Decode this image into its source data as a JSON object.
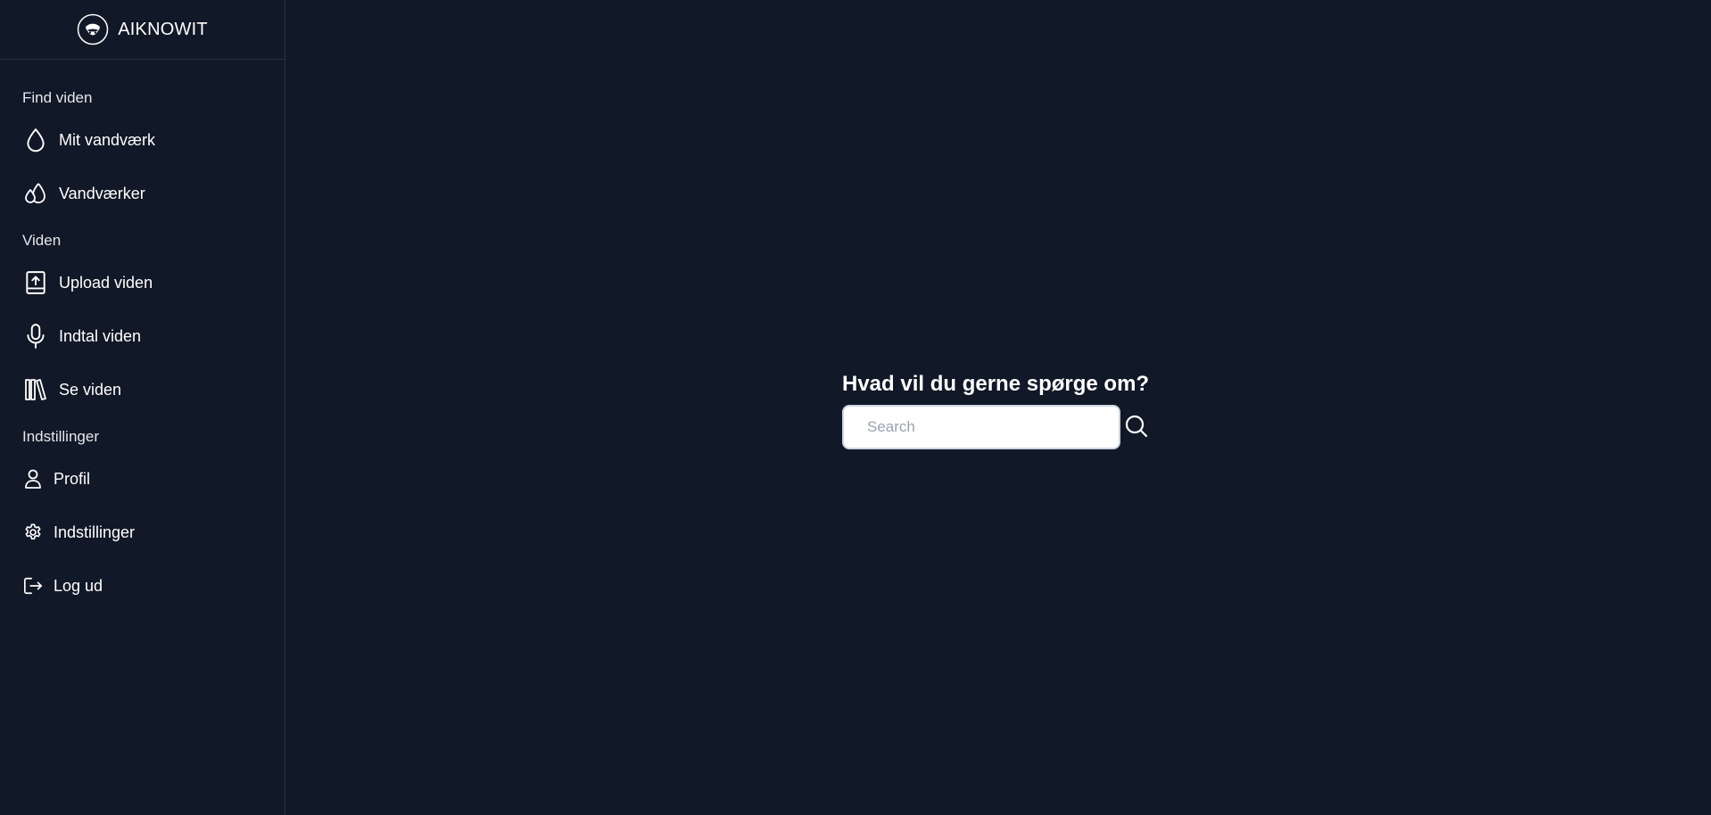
{
  "brand": {
    "name": "AIKNOWIT"
  },
  "sidebar": {
    "sections": [
      {
        "label": "Find viden",
        "items": [
          {
            "label": "Mit vandværk",
            "icon": "droplet-icon"
          },
          {
            "label": "Vandværker",
            "icon": "droplets-icon"
          }
        ]
      },
      {
        "label": "Viden",
        "items": [
          {
            "label": "Upload viden",
            "icon": "upload-book-icon"
          },
          {
            "label": "Indtal viden",
            "icon": "microphone-icon"
          },
          {
            "label": "Se viden",
            "icon": "library-icon"
          }
        ]
      },
      {
        "label": "Indstillinger",
        "items": [
          {
            "label": "Profil",
            "icon": "user-icon"
          },
          {
            "label": "Indstillinger",
            "icon": "gear-icon"
          },
          {
            "label": "Log ud",
            "icon": "logout-icon"
          }
        ]
      }
    ]
  },
  "main": {
    "question": "Hvad vil du gerne spørge om?",
    "search": {
      "placeholder": "Search",
      "value": ""
    }
  },
  "colors": {
    "background": "#111827",
    "divider": "#2a3342",
    "text": "#ffffff",
    "input_bg": "#ffffff",
    "placeholder": "#9ca3af"
  }
}
